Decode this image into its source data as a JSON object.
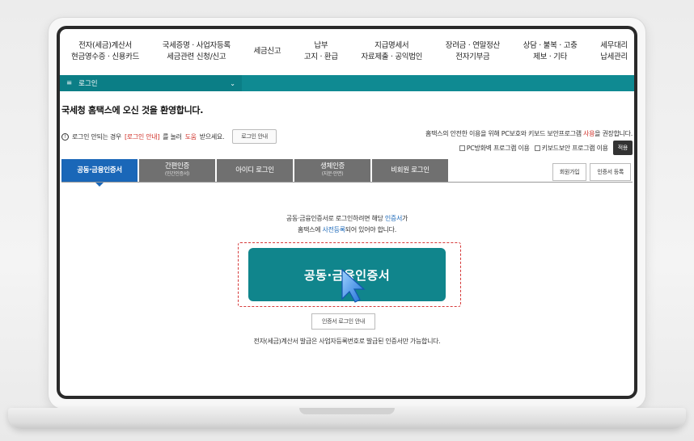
{
  "nav": {
    "items": [
      {
        "line1": "전자(세금)계산서",
        "line2": "현금영수증 · 신용카드"
      },
      {
        "line1": "국세증명 · 사업자등록",
        "line2": "세금관련 신청/신고"
      },
      {
        "line1": "세금신고",
        "line2": ""
      },
      {
        "line1": "납부",
        "line2": "고지 · 환급"
      },
      {
        "line1": "지급명세서",
        "line2": "자료제출 · 공익법인"
      },
      {
        "line1": "장려금 · 연말정산",
        "line2": "전자기부금"
      },
      {
        "line1": "상담 · 불복 · 고충",
        "line2": "제보 · 기타"
      },
      {
        "line1": "세무대리",
        "line2": "납세관리"
      }
    ]
  },
  "breadcrumb": {
    "label": "로그인",
    "menu_glyph": "≡",
    "chevron": "⌄"
  },
  "welcome": "국세청 홈택스에 오신 것을 환영합니다.",
  "help": {
    "prefix": "로그인 안되는 경우",
    "link": "[로그인 안내]",
    "middle": "를 눌러",
    "help_word": "도움",
    "suffix": "받으세요.",
    "button": "로그인 안내"
  },
  "notice": {
    "prefix": "홈택스의 안전한 이용을 위해 PC보호와 키보드 보안프로그램",
    "highlight": "사용",
    "suffix": "을 권장합니다."
  },
  "checks": {
    "pc_protect": "PC방화벽 프로그램 이용",
    "keyboard": "키보드보안 프로그램 이용",
    "apply": "적용"
  },
  "tabs": [
    {
      "label": "공동·금융인증서",
      "sub": ""
    },
    {
      "label": "간편인증",
      "sub": "(민간인증서)"
    },
    {
      "label": "아이디 로그인",
      "sub": ""
    },
    {
      "label": "생체인증",
      "sub": "(지문·안면)"
    },
    {
      "label": "비회원 로그인",
      "sub": ""
    }
  ],
  "right_buttons": {
    "signup": "회원가입",
    "register_cert": "인증서 등록"
  },
  "desc": {
    "line1_pre": "공동·금융인증서로 로그인하려면 해당",
    "line1_link": "인증서",
    "line1_post": "가",
    "line2_pre": "홈택스에",
    "line2_link": "사전등록",
    "line2_post": "되어 있어야 합니다."
  },
  "cert_button": "공동·금융인증서",
  "guide_button": "인증서 로그인 안내",
  "footnote": "전자(세금)계산서 발급은 사업자등록번호로 발급된 인증서만 가능합니다.",
  "colors": {
    "teal": "#10858c",
    "tab_active": "#1a67b8",
    "tab": "#707070",
    "red": "#d0322a"
  }
}
